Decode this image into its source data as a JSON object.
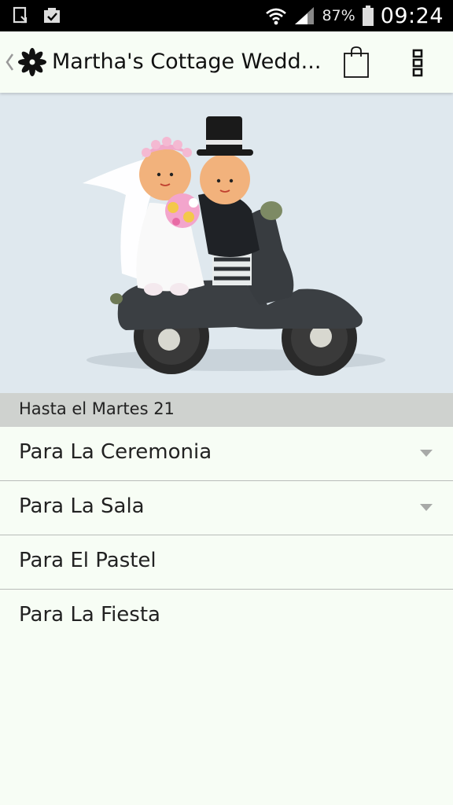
{
  "status_bar": {
    "battery_percent": "87%",
    "time": "09:24",
    "icons": [
      "download-complete-icon",
      "clipboard-check-icon",
      "wifi-icon",
      "signal-icon",
      "battery-icon"
    ]
  },
  "app_bar": {
    "title": "Martha's Cottage Wedd...",
    "icons": [
      "back-chevron-icon",
      "flower-logo-icon",
      "shopping-bag-icon",
      "overflow-menu-icon"
    ]
  },
  "hero": {
    "image": "wedding-couple-scooter-figurine"
  },
  "section": {
    "header": "Hasta el Martes 21"
  },
  "menu": {
    "items": [
      {
        "label": "Para La Ceremonia",
        "expandable": true
      },
      {
        "label": "Para La Sala",
        "expandable": true
      },
      {
        "label": "Para El Pastel",
        "expandable": false
      },
      {
        "label": "Para La Fiesta",
        "expandable": false
      }
    ]
  },
  "colors": {
    "status_bar_bg": "#000000",
    "app_bg": "#f7fdf5",
    "hero_bg": "#dfe8ee",
    "section_header_bg": "#cfd2cf",
    "divider": "#b9bcb9"
  }
}
